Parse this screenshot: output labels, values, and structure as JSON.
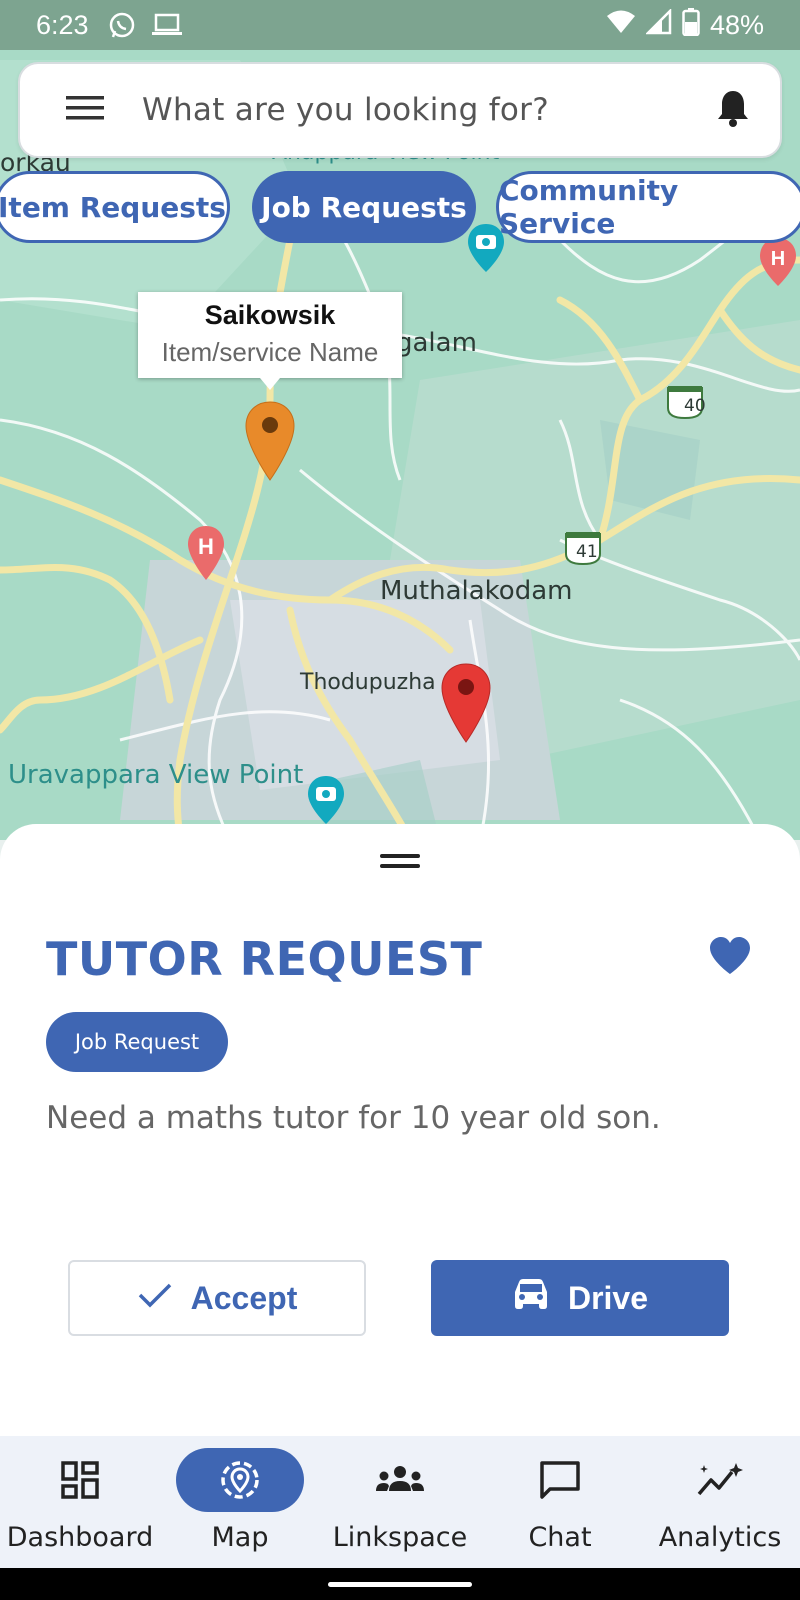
{
  "status_bar": {
    "time": "6:23",
    "battery": "48%",
    "icons": [
      "whatsapp-icon",
      "laptop-icon",
      "wifi-icon",
      "signal-icon",
      "battery-icon"
    ]
  },
  "search": {
    "placeholder": "What are you looking for?",
    "menu_icon": "menu-icon",
    "notification_icon": "bell-icon"
  },
  "filters": [
    {
      "label": "Item Requests",
      "selected": false
    },
    {
      "label": "Job Requests",
      "selected": true
    },
    {
      "label": "Community Service",
      "selected": false
    }
  ],
  "map": {
    "labels": {
      "muthalakodam": "Muthalakodam",
      "thodupuzha": "Thodupuzha",
      "uravappara": "Uravappara View Point",
      "galam": "galam",
      "orkau": "orkau",
      "anappara": "Anappara View Point",
      "highway_40": "40",
      "highway_41": "41",
      "hospital": "H"
    },
    "info_window": {
      "title": "Saikowsik",
      "subtitle": "Item/service Name"
    }
  },
  "sheet": {
    "title": "TUTOR REQUEST",
    "badge": "Job Request",
    "description": "Need a maths tutor for 10 year old son.",
    "accept_label": "Accept",
    "drive_label": "Drive",
    "favorite": true
  },
  "nav": {
    "items": [
      {
        "label": "Dashboard",
        "icon": "dashboard-icon"
      },
      {
        "label": "Map",
        "icon": "map-icon",
        "active": true
      },
      {
        "label": "Linkspace",
        "icon": "people-icon"
      },
      {
        "label": "Chat",
        "icon": "chat-icon"
      },
      {
        "label": "Analytics",
        "icon": "analytics-icon"
      }
    ]
  },
  "colors": {
    "primary": "#3f66b3",
    "pin_orange": "#e88a2a",
    "pin_red": "#e53935",
    "map_bg": "#a9dcc9"
  }
}
